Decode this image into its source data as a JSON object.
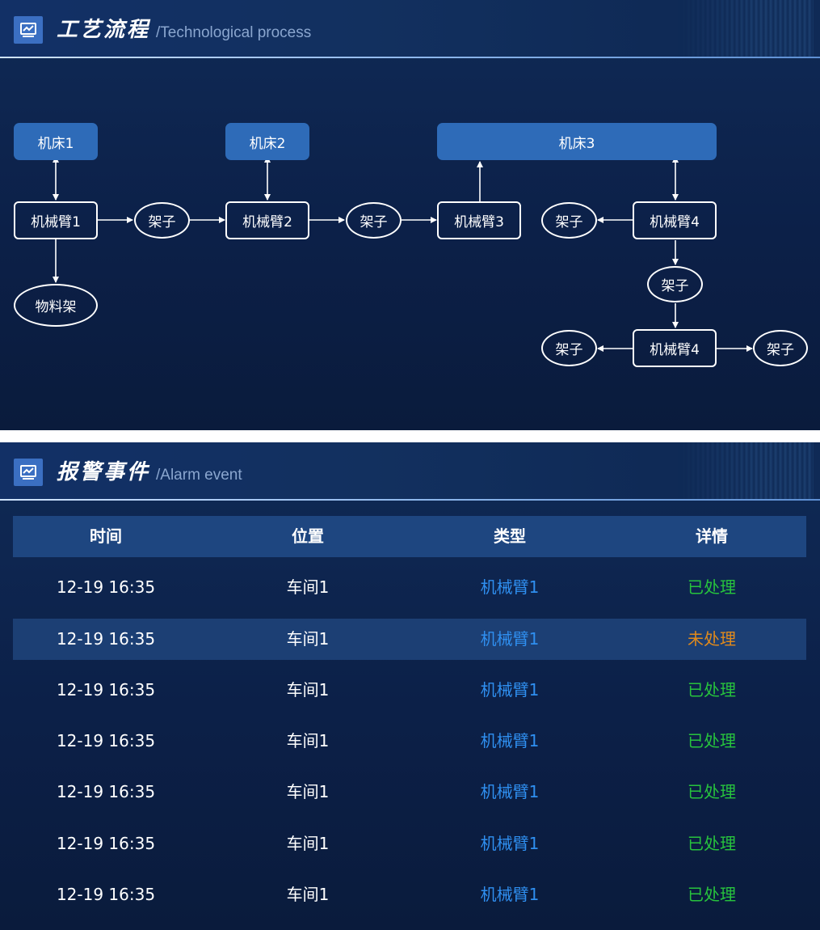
{
  "process_panel": {
    "title": "工艺流程",
    "subtitle": "/Technological process",
    "nodes": {
      "machine1": "机床1",
      "machine2": "机床2",
      "machine3": "机床3",
      "arm1": "机械臂1",
      "arm2": "机械臂2",
      "arm3": "机械臂3",
      "arm4a": "机械臂4",
      "arm4b": "机械臂4",
      "rack1": "架子",
      "rack2": "架子",
      "rack3": "架子",
      "rack4": "架子",
      "rack5": "架子",
      "rack6": "架子",
      "material_rack": "物料架"
    }
  },
  "alarm_panel": {
    "title": "报警事件",
    "subtitle": "/Alarm event",
    "columns": [
      "时间",
      "位置",
      "类型",
      "详情"
    ],
    "rows": [
      {
        "time": "12-19  16:35",
        "location": "车间1",
        "type": "机械臂1",
        "detail": "已处理",
        "status": "done"
      },
      {
        "time": "12-19  16:35",
        "location": "车间1",
        "type": "机械臂1",
        "detail": "未处理",
        "status": "pending"
      },
      {
        "time": "12-19  16:35",
        "location": "车间1",
        "type": "机械臂1",
        "detail": "已处理",
        "status": "done"
      },
      {
        "time": "12-19  16:35",
        "location": "车间1",
        "type": "机械臂1",
        "detail": "已处理",
        "status": "done"
      },
      {
        "time": "12-19  16:35",
        "location": "车间1",
        "type": "机械臂1",
        "detail": "已处理",
        "status": "done"
      },
      {
        "time": "12-19  16:35",
        "location": "车间1",
        "type": "机械臂1",
        "detail": "已处理",
        "status": "done"
      },
      {
        "time": "12-19  16:35",
        "location": "车间1",
        "type": "机械臂1",
        "detail": "已处理",
        "status": "done"
      }
    ]
  },
  "colors": {
    "background": "#0c2048",
    "machine_fill": "#2e6bb8",
    "type_text": "#2f8ff0",
    "done_text": "#27c33d",
    "pending_text": "#e08a1c"
  },
  "icons": {
    "header_icon": "monitor-chart-icon"
  }
}
